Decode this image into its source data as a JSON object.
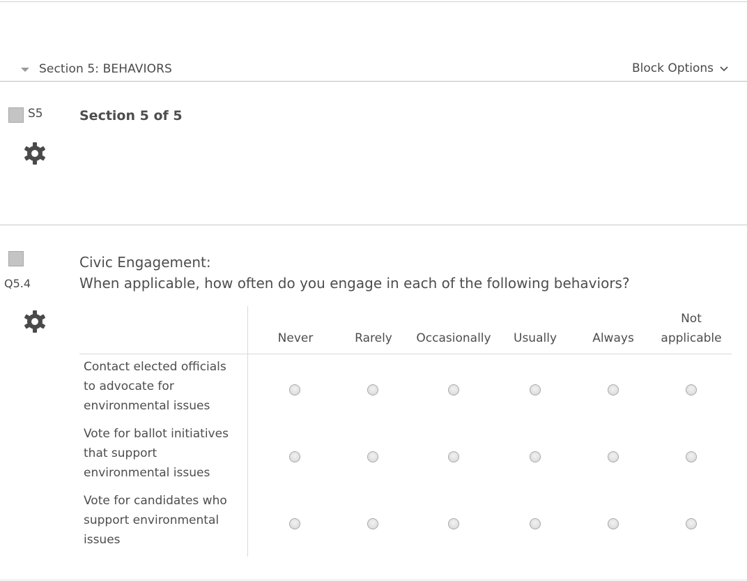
{
  "block": {
    "title": "Section 5: BEHAVIORS",
    "options_label": "Block Options"
  },
  "questions": [
    {
      "id": "S5",
      "text": "Section 5 of 5"
    },
    {
      "id": "Q5.4",
      "text_line1": "Civic Engagement:",
      "text_line2": "When applicable, how often do you engage in each of the following behaviors?",
      "columns": [
        "Never",
        "Rarely",
        "Occasionally",
        "Usually",
        "Always",
        "Not applicable"
      ],
      "rows": [
        "Contact elected officials to advocate for environmental issues",
        "Vote for ballot initiatives that support environmental issues",
        "Vote for candidates who support environmental issues"
      ]
    }
  ],
  "icons": {
    "collapse": "caret-down-icon",
    "options": "chevron-down-icon",
    "settings": "gear-icon"
  },
  "colors": {
    "text": "#4d4d4d",
    "checkbox": "#c4c4c4",
    "divider": "#c9c9c9"
  }
}
